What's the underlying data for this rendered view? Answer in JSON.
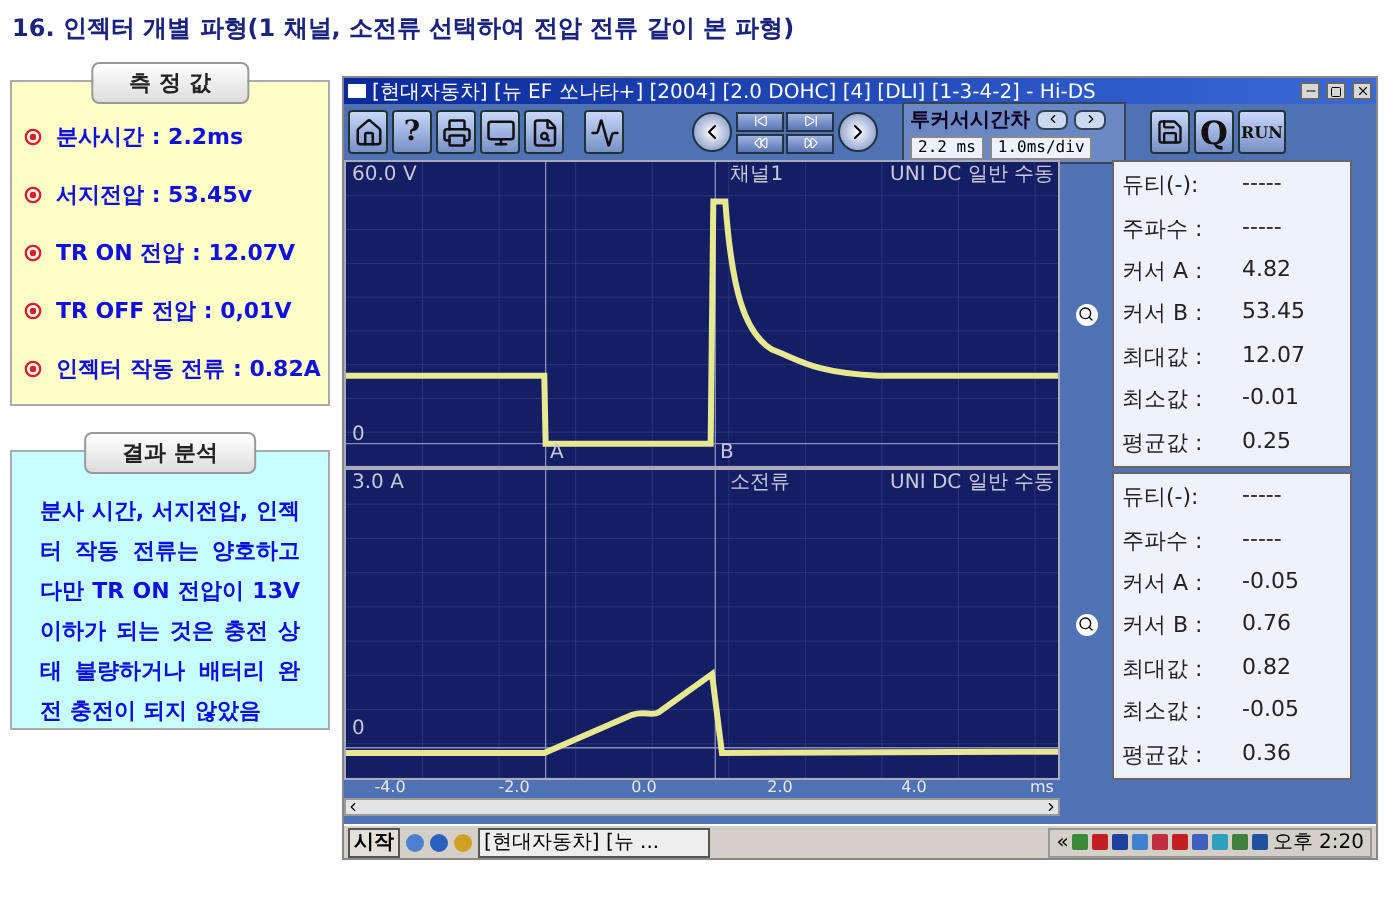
{
  "title": "16. 인젝터 개별 파형(1 채널, 소전류 선택하여 전압 전류 같이 본 파형)",
  "measurements": {
    "heading": "측 정 값",
    "items": [
      {
        "text": "분사시간 : 2.2ms"
      },
      {
        "text": "서지전압 : 53.45v"
      },
      {
        "text": "TR ON 전압 : 12.07V"
      },
      {
        "text": "TR OFF 전압 : 0,01V"
      },
      {
        "text": "인젝터 작동 전류 : 0.82A"
      }
    ]
  },
  "analysis": {
    "heading": "결과 분석",
    "text": "분사 시간, 서지전압, 인젝터 작동 전류는 양호하고 다만 TR ON 전압이 13V 이하가 되는 것은 충전 상태 불량하거나 배터리 완전 충전이 되지 않았음"
  },
  "app": {
    "window": {
      "title": "[현대자동차] [뉴 EF 쏘나타+] [2004] [2.0 DOHC] [4] [DLI] [1-3-4-2] - Hi-DS"
    },
    "toolbar": {
      "help": "?",
      "cursor_time": {
        "label": "투커서시간차",
        "value": "2.2 ms",
        "scale": "1.0ms/div"
      },
      "quit": "Q",
      "run": "RUN"
    },
    "channels": [
      {
        "kind": "voltage",
        "scale": "60.0 V",
        "name": "채널1",
        "mode": "UNI DC  일반  수동",
        "zero": "0",
        "cursors": [
          "A",
          "B"
        ],
        "readouts": [
          {
            "label": "듀티(-):",
            "value": "-----"
          },
          {
            "label": "주파수 :",
            "value": "-----"
          },
          {
            "label": "커서 A :",
            "value": "4.82"
          },
          {
            "label": "커서 B :",
            "value": "53.45"
          },
          {
            "label": "최대값 :",
            "value": "12.07"
          },
          {
            "label": "최소값 :",
            "value": "-0.01"
          },
          {
            "label": "평균값 :",
            "value": "0.25"
          }
        ]
      },
      {
        "kind": "current",
        "scale": "3.0 A",
        "name": "소전류",
        "mode": "UNI DC  일반  수동",
        "zero": "0",
        "readouts": [
          {
            "label": "듀티(-):",
            "value": "-----"
          },
          {
            "label": "주파수 :",
            "value": "-----"
          },
          {
            "label": "커서 A :",
            "value": "-0.05"
          },
          {
            "label": "커서 B :",
            "value": "0.76"
          },
          {
            "label": "최대값 :",
            "value": "0.82"
          },
          {
            "label": "최소값 :",
            "value": "-0.05"
          },
          {
            "label": "평균값 :",
            "value": "0.36"
          }
        ]
      }
    ],
    "x_axis": {
      "ticks": [
        "-4.0",
        "-2.0",
        "0.0",
        "2.0",
        "4.0"
      ],
      "unit": "ms"
    },
    "taskbar": {
      "start": "시작",
      "task": "[현대자동차] [뉴 ...",
      "collapse": "«",
      "time": "오후 2:20"
    }
  }
}
